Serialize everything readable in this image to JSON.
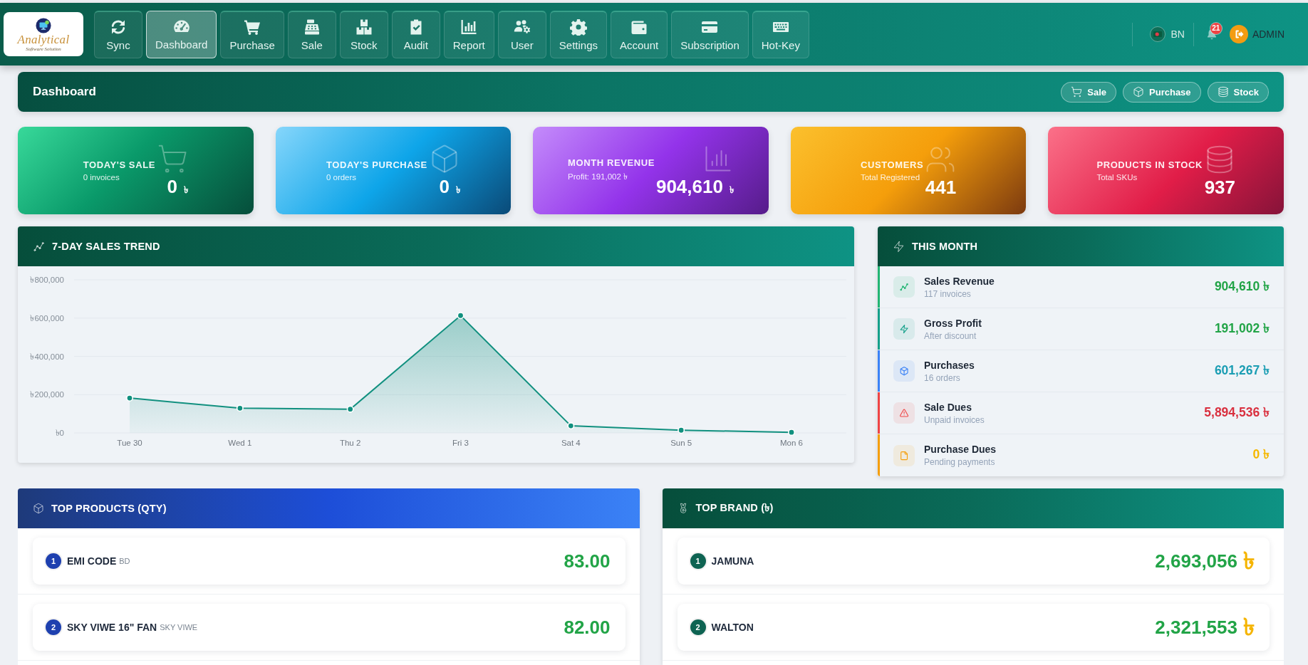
{
  "nav": {
    "logo": {
      "title": "Analytical",
      "subtitle": "Software Solution"
    },
    "items": [
      {
        "label": "Sync",
        "selected": false
      },
      {
        "label": "Dashboard",
        "selected": true
      },
      {
        "label": "Purchase",
        "selected": false
      },
      {
        "label": "Sale",
        "selected": false
      },
      {
        "label": "Stock",
        "selected": false
      },
      {
        "label": "Audit",
        "selected": false
      },
      {
        "label": "Report",
        "selected": false
      },
      {
        "label": "User",
        "selected": false
      },
      {
        "label": "Settings",
        "selected": false
      },
      {
        "label": "Account",
        "selected": false
      },
      {
        "label": "Subscription",
        "selected": false
      },
      {
        "label": "Hot-Key",
        "selected": false
      }
    ],
    "language": "BN",
    "notifications": "21",
    "user": "ADMIN"
  },
  "header": {
    "title": "Dashboard",
    "actions": [
      "Sale",
      "Purchase",
      "Stock"
    ]
  },
  "stats": [
    {
      "label": "TODAY'S SALE",
      "sub": "0 invoices",
      "value": "0",
      "unit": "৳"
    },
    {
      "label": "TODAY'S PURCHASE",
      "sub": "0 orders",
      "value": "0",
      "unit": "৳"
    },
    {
      "label": "MONTH REVENUE",
      "sub": "Profit: 191,002 ৳",
      "value": "904,610",
      "unit": "৳"
    },
    {
      "label": "CUSTOMERS",
      "sub": "Total Registered",
      "value": "441"
    },
    {
      "label": "PRODUCTS IN STOCK",
      "sub": "Total SKUs",
      "value": "937"
    }
  ],
  "sales_trend": {
    "title": "7-DAY SALES TREND",
    "chart_data": {
      "type": "area",
      "categories": [
        "Tue 30",
        "Wed 1",
        "Thu 2",
        "Fri 3",
        "Sat 4",
        "Sun 5",
        "Mon 6"
      ],
      "values": [
        182000,
        129000,
        124000,
        613000,
        37000,
        14000,
        3000
      ],
      "ylim": [
        0,
        800000
      ],
      "yticks": [
        {
          "value": 0,
          "label": "৳0"
        },
        {
          "value": 200000,
          "label": "৳200,000"
        },
        {
          "value": 400000,
          "label": "৳400,000"
        },
        {
          "value": 600000,
          "label": "৳600,000"
        },
        {
          "value": 800000,
          "label": "৳800,000"
        }
      ],
      "grid": true
    }
  },
  "this_month": {
    "title": "THIS MONTH",
    "rows": [
      {
        "kind": "revenue",
        "title": "Sales Revenue",
        "sub": "117 invoices",
        "value": "904,610 ৳",
        "color": "#22b573"
      },
      {
        "kind": "profit",
        "title": "Gross Profit",
        "sub": "After discount",
        "value": "191,002 ৳",
        "color": "#14a08a"
      },
      {
        "kind": "purchases",
        "title": "Purchases",
        "sub": "16 orders",
        "value": "601,267 ৳",
        "color": "#3b82f6"
      },
      {
        "kind": "dues",
        "title": "Sale Dues",
        "sub": "Unpaid invoices",
        "value": "5,894,536 ৳",
        "color": "#ef4444"
      },
      {
        "kind": "payables",
        "title": "Purchase Dues",
        "sub": "Pending payments",
        "value": "0 ৳",
        "color": "#f59e0b"
      }
    ]
  },
  "top_products": {
    "title": "TOP PRODUCTS (QTY)",
    "items": [
      {
        "rank": "1",
        "name": "EMI CODE",
        "brand": "BD",
        "value": "83.00"
      },
      {
        "rank": "2",
        "name": "SKY VIWE 16\" FAN",
        "brand": "SKY VIWE",
        "value": "82.00"
      }
    ]
  },
  "top_brands": {
    "title": "TOP BRAND (৳)",
    "items": [
      {
        "rank": "1",
        "name": "JAMUNA",
        "value": "2,693,056",
        "unit": "৳"
      },
      {
        "rank": "2",
        "name": "WALTON",
        "value": "2,321,553",
        "unit": "৳"
      }
    ]
  }
}
